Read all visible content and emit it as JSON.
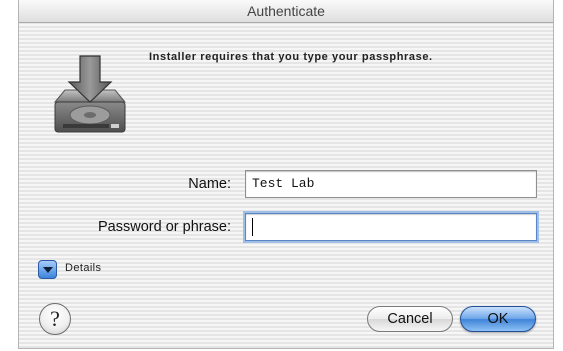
{
  "window": {
    "title": "Authenticate"
  },
  "dialog": {
    "prompt": "Installer requires that you type your passphrase.",
    "icon": "installer-disk-download-icon"
  },
  "form": {
    "name_label": "Name:",
    "name_value": "Test  Lab",
    "password_label": "Password or phrase:",
    "password_value": ""
  },
  "details": {
    "label": "Details",
    "icon": "disclosure-triangle-icon",
    "expanded": false
  },
  "buttons": {
    "help_glyph": "?",
    "cancel_label": "Cancel",
    "ok_label": "OK"
  },
  "colors": {
    "default_button": "#4a8ee0",
    "focus_ring": "#9fbfe8",
    "disclosure": "#3c84dc"
  }
}
